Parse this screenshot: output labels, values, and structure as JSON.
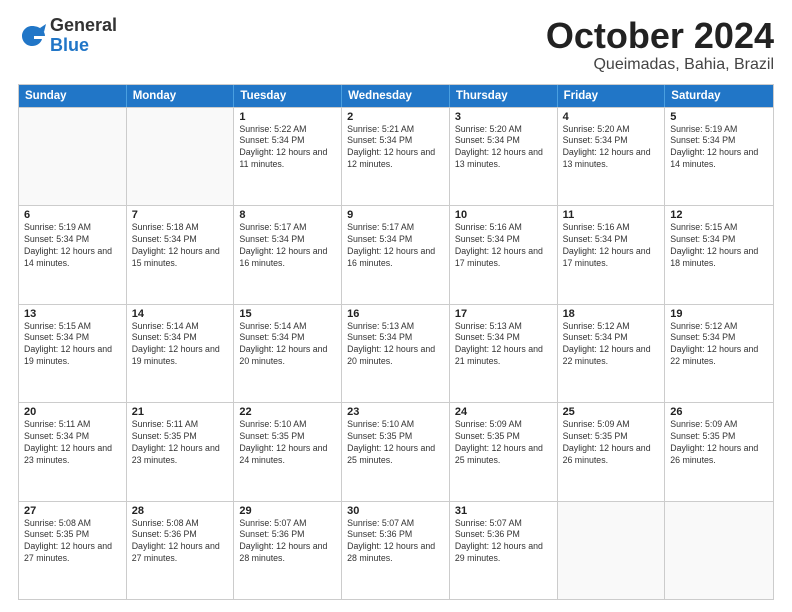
{
  "logo": {
    "general": "General",
    "blue": "Blue"
  },
  "header": {
    "title": "October 2024",
    "subtitle": "Queimadas, Bahia, Brazil"
  },
  "weekdays": [
    "Sunday",
    "Monday",
    "Tuesday",
    "Wednesday",
    "Thursday",
    "Friday",
    "Saturday"
  ],
  "rows": [
    [
      {
        "day": "",
        "empty": true
      },
      {
        "day": "",
        "empty": true
      },
      {
        "day": "1",
        "sunrise": "Sunrise: 5:22 AM",
        "sunset": "Sunset: 5:34 PM",
        "daylight": "Daylight: 12 hours and 11 minutes."
      },
      {
        "day": "2",
        "sunrise": "Sunrise: 5:21 AM",
        "sunset": "Sunset: 5:34 PM",
        "daylight": "Daylight: 12 hours and 12 minutes."
      },
      {
        "day": "3",
        "sunrise": "Sunrise: 5:20 AM",
        "sunset": "Sunset: 5:34 PM",
        "daylight": "Daylight: 12 hours and 13 minutes."
      },
      {
        "day": "4",
        "sunrise": "Sunrise: 5:20 AM",
        "sunset": "Sunset: 5:34 PM",
        "daylight": "Daylight: 12 hours and 13 minutes."
      },
      {
        "day": "5",
        "sunrise": "Sunrise: 5:19 AM",
        "sunset": "Sunset: 5:34 PM",
        "daylight": "Daylight: 12 hours and 14 minutes."
      }
    ],
    [
      {
        "day": "6",
        "sunrise": "Sunrise: 5:19 AM",
        "sunset": "Sunset: 5:34 PM",
        "daylight": "Daylight: 12 hours and 14 minutes."
      },
      {
        "day": "7",
        "sunrise": "Sunrise: 5:18 AM",
        "sunset": "Sunset: 5:34 PM",
        "daylight": "Daylight: 12 hours and 15 minutes."
      },
      {
        "day": "8",
        "sunrise": "Sunrise: 5:17 AM",
        "sunset": "Sunset: 5:34 PM",
        "daylight": "Daylight: 12 hours and 16 minutes."
      },
      {
        "day": "9",
        "sunrise": "Sunrise: 5:17 AM",
        "sunset": "Sunset: 5:34 PM",
        "daylight": "Daylight: 12 hours and 16 minutes."
      },
      {
        "day": "10",
        "sunrise": "Sunrise: 5:16 AM",
        "sunset": "Sunset: 5:34 PM",
        "daylight": "Daylight: 12 hours and 17 minutes."
      },
      {
        "day": "11",
        "sunrise": "Sunrise: 5:16 AM",
        "sunset": "Sunset: 5:34 PM",
        "daylight": "Daylight: 12 hours and 17 minutes."
      },
      {
        "day": "12",
        "sunrise": "Sunrise: 5:15 AM",
        "sunset": "Sunset: 5:34 PM",
        "daylight": "Daylight: 12 hours and 18 minutes."
      }
    ],
    [
      {
        "day": "13",
        "sunrise": "Sunrise: 5:15 AM",
        "sunset": "Sunset: 5:34 PM",
        "daylight": "Daylight: 12 hours and 19 minutes."
      },
      {
        "day": "14",
        "sunrise": "Sunrise: 5:14 AM",
        "sunset": "Sunset: 5:34 PM",
        "daylight": "Daylight: 12 hours and 19 minutes."
      },
      {
        "day": "15",
        "sunrise": "Sunrise: 5:14 AM",
        "sunset": "Sunset: 5:34 PM",
        "daylight": "Daylight: 12 hours and 20 minutes."
      },
      {
        "day": "16",
        "sunrise": "Sunrise: 5:13 AM",
        "sunset": "Sunset: 5:34 PM",
        "daylight": "Daylight: 12 hours and 20 minutes."
      },
      {
        "day": "17",
        "sunrise": "Sunrise: 5:13 AM",
        "sunset": "Sunset: 5:34 PM",
        "daylight": "Daylight: 12 hours and 21 minutes."
      },
      {
        "day": "18",
        "sunrise": "Sunrise: 5:12 AM",
        "sunset": "Sunset: 5:34 PM",
        "daylight": "Daylight: 12 hours and 22 minutes."
      },
      {
        "day": "19",
        "sunrise": "Sunrise: 5:12 AM",
        "sunset": "Sunset: 5:34 PM",
        "daylight": "Daylight: 12 hours and 22 minutes."
      }
    ],
    [
      {
        "day": "20",
        "sunrise": "Sunrise: 5:11 AM",
        "sunset": "Sunset: 5:34 PM",
        "daylight": "Daylight: 12 hours and 23 minutes."
      },
      {
        "day": "21",
        "sunrise": "Sunrise: 5:11 AM",
        "sunset": "Sunset: 5:35 PM",
        "daylight": "Daylight: 12 hours and 23 minutes."
      },
      {
        "day": "22",
        "sunrise": "Sunrise: 5:10 AM",
        "sunset": "Sunset: 5:35 PM",
        "daylight": "Daylight: 12 hours and 24 minutes."
      },
      {
        "day": "23",
        "sunrise": "Sunrise: 5:10 AM",
        "sunset": "Sunset: 5:35 PM",
        "daylight": "Daylight: 12 hours and 25 minutes."
      },
      {
        "day": "24",
        "sunrise": "Sunrise: 5:09 AM",
        "sunset": "Sunset: 5:35 PM",
        "daylight": "Daylight: 12 hours and 25 minutes."
      },
      {
        "day": "25",
        "sunrise": "Sunrise: 5:09 AM",
        "sunset": "Sunset: 5:35 PM",
        "daylight": "Daylight: 12 hours and 26 minutes."
      },
      {
        "day": "26",
        "sunrise": "Sunrise: 5:09 AM",
        "sunset": "Sunset: 5:35 PM",
        "daylight": "Daylight: 12 hours and 26 minutes."
      }
    ],
    [
      {
        "day": "27",
        "sunrise": "Sunrise: 5:08 AM",
        "sunset": "Sunset: 5:35 PM",
        "daylight": "Daylight: 12 hours and 27 minutes."
      },
      {
        "day": "28",
        "sunrise": "Sunrise: 5:08 AM",
        "sunset": "Sunset: 5:36 PM",
        "daylight": "Daylight: 12 hours and 27 minutes."
      },
      {
        "day": "29",
        "sunrise": "Sunrise: 5:07 AM",
        "sunset": "Sunset: 5:36 PM",
        "daylight": "Daylight: 12 hours and 28 minutes."
      },
      {
        "day": "30",
        "sunrise": "Sunrise: 5:07 AM",
        "sunset": "Sunset: 5:36 PM",
        "daylight": "Daylight: 12 hours and 28 minutes."
      },
      {
        "day": "31",
        "sunrise": "Sunrise: 5:07 AM",
        "sunset": "Sunset: 5:36 PM",
        "daylight": "Daylight: 12 hours and 29 minutes."
      },
      {
        "day": "",
        "empty": true
      },
      {
        "day": "",
        "empty": true
      }
    ]
  ]
}
